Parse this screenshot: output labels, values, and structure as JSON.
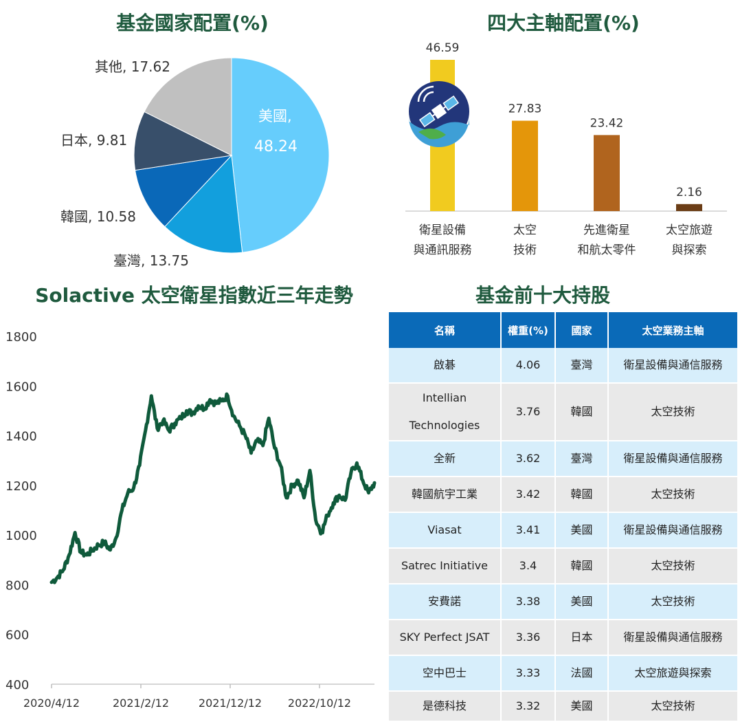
{
  "titles": {
    "country": "基金國家配置(%)",
    "axes": "四大主軸配置(%)",
    "trend": "Solactive  太空衛星指數近三年走勢",
    "holdings": "基金前十大持股"
  },
  "chart_data": [
    {
      "type": "pie",
      "title": "基金國家配置(%)",
      "slices": [
        {
          "label": "美國",
          "value": 48.24,
          "color": "#66cdfc"
        },
        {
          "label": "臺灣",
          "value": 13.75,
          "color": "#129fdd"
        },
        {
          "label": "韓國",
          "value": 10.58,
          "color": "#0a68b8"
        },
        {
          "label": "日本",
          "value": 9.81,
          "color": "#384f6a"
        },
        {
          "label": "其他",
          "value": 17.62,
          "color": "#c0c0c0"
        }
      ]
    },
    {
      "type": "bar",
      "title": "四大主軸配置(%)",
      "categories": [
        [
          "衛星設備",
          "與通訊服務"
        ],
        [
          "太空",
          "技術"
        ],
        [
          "先進衛星",
          "和航太零件"
        ],
        [
          "太空旅遊",
          "與探索"
        ]
      ],
      "values": [
        46.59,
        27.83,
        23.42,
        2.16
      ],
      "colors": [
        "#f1cb1f",
        "#e4960a",
        "#b0641e",
        "#6b3d16"
      ],
      "value_labels": [
        "46.59",
        "27.83",
        "23.42",
        "2.16"
      ]
    },
    {
      "type": "line",
      "title": "Solactive  太空衛星指數近三年走勢",
      "series": [
        {
          "color": "#0f5a3b",
          "points": [
            [
              "2020/4/12",
              810
            ],
            [
              "2020/5/3",
              830
            ],
            [
              "2020/5/24",
              860
            ],
            [
              "2020/6/14",
              920
            ],
            [
              "2020/6/28",
              1010
            ],
            [
              "2020/7/12",
              930
            ],
            [
              "2020/8/2",
              920
            ],
            [
              "2020/8/23",
              940
            ],
            [
              "2020/9/13",
              960
            ],
            [
              "2020/10/4",
              970
            ],
            [
              "2020/10/25",
              940
            ],
            [
              "2020/11/15",
              990
            ],
            [
              "2020/12/6",
              1100
            ],
            [
              "2020/12/27",
              1170
            ],
            [
              "2021/1/17",
              1190
            ],
            [
              "2021/2/7",
              1280
            ],
            [
              "2021/2/21",
              1420
            ],
            [
              "2021/3/7",
              1560
            ],
            [
              "2021/3/21",
              1430
            ],
            [
              "2021/4/11",
              1460
            ],
            [
              "2021/5/2",
              1420
            ],
            [
              "2021/5/23",
              1450
            ],
            [
              "2021/6/13",
              1470
            ],
            [
              "2021/7/4",
              1500
            ],
            [
              "2021/7/25",
              1490
            ],
            [
              "2021/8/15",
              1520
            ],
            [
              "2021/9/5",
              1510
            ],
            [
              "2021/9/26",
              1545
            ],
            [
              "2021/10/17",
              1530
            ],
            [
              "2021/11/7",
              1540
            ],
            [
              "2021/11/28",
              1560
            ],
            [
              "2021/12/19",
              1480
            ],
            [
              "2022/1/9",
              1440
            ],
            [
              "2022/1/30",
              1400
            ],
            [
              "2022/2/20",
              1330
            ],
            [
              "2022/3/13",
              1380
            ],
            [
              "2022/4/3",
              1360
            ],
            [
              "2022/4/24",
              1470
            ],
            [
              "2022/5/15",
              1350
            ],
            [
              "2022/6/5",
              1280
            ],
            [
              "2022/6/26",
              1150
            ],
            [
              "2022/7/17",
              1200
            ],
            [
              "2022/8/7",
              1220
            ],
            [
              "2022/8/28",
              1150
            ],
            [
              "2022/9/18",
              1260
            ],
            [
              "2022/10/9",
              1060
            ],
            [
              "2022/10/23",
              1010
            ],
            [
              "2022/11/13",
              1080
            ],
            [
              "2022/12/4",
              1130
            ],
            [
              "2022/12/25",
              1160
            ],
            [
              "2023/1/15",
              1140
            ],
            [
              "2023/2/5",
              1250
            ],
            [
              "2023/2/19",
              1290
            ],
            [
              "2023/3/12",
              1220
            ],
            [
              "2023/4/2",
              1170
            ],
            [
              "2023/4/23",
              1210
            ]
          ]
        }
      ],
      "ylim": [
        400,
        1800
      ],
      "yticks": [
        "1800",
        "1600",
        "1400",
        "1200",
        "1000",
        "800",
        "600",
        "400"
      ],
      "xticks": [
        "2020/4/12",
        "2021/2/12",
        "2021/12/12",
        "2022/10/12"
      ]
    }
  ],
  "pie_labels": {
    "us_name": "美國,",
    "us_value": "48.24",
    "tw": "臺灣, 13.75",
    "kr": "韓國, 10.58",
    "jp": "日本, 9.81",
    "other": "其他, 17.62"
  },
  "holdings": {
    "headers": [
      "名稱",
      "權重(%)",
      "國家",
      "太空業務主軸"
    ],
    "rows": [
      {
        "name": "啟碁",
        "weight": "4.06",
        "country": "臺灣",
        "axis": "衛星設備與通信服務"
      },
      {
        "name": "Intellian\nTechnologies",
        "weight": "3.76",
        "country": "韓國",
        "axis": "太空技術"
      },
      {
        "name": "全新",
        "weight": "3.62",
        "country": "臺灣",
        "axis": "衛星設備與通信服務"
      },
      {
        "name": "韓國航宇工業",
        "weight": "3.42",
        "country": "韓國",
        "axis": "太空技術"
      },
      {
        "name": "Viasat",
        "weight": "3.41",
        "country": "美國",
        "axis": "衛星設備與通信服務"
      },
      {
        "name": "Satrec Initiative",
        "weight": "3.4",
        "country": "韓國",
        "axis": "太空技術"
      },
      {
        "name": "安費諾",
        "weight": "3.38",
        "country": "美國",
        "axis": "太空技術"
      },
      {
        "name": "SKY Perfect JSAT",
        "weight": "3.36",
        "country": "日本",
        "axis": "衛星設備與通信服務"
      },
      {
        "name": "空中巴士",
        "weight": "3.33",
        "country": "法國",
        "axis": "太空旅遊與探索"
      },
      {
        "name": "是德科技",
        "weight": "3.32",
        "country": "美國",
        "axis": "太空技術"
      }
    ]
  },
  "icons": {
    "bar_icon": "satellite-icon"
  }
}
